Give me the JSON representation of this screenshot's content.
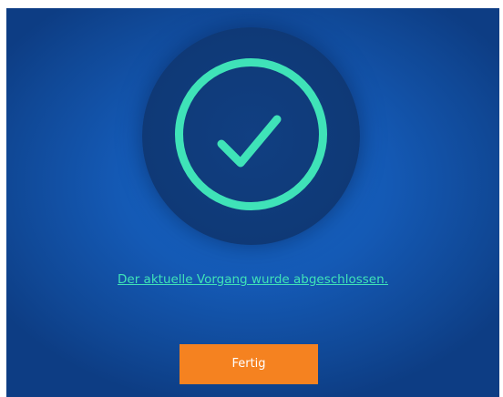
{
  "dialog": {
    "status_icon": "checkmark-circle-icon",
    "message": "Der aktuelle Vorgang wurde abgeschlossen.",
    "done_button_label": "Fertig"
  },
  "colors": {
    "background": "#1459b4",
    "icon_circle": "#0f3a78",
    "accent_green": "#3fe3b8",
    "button_orange": "#f58220",
    "button_text": "#ffffff"
  }
}
